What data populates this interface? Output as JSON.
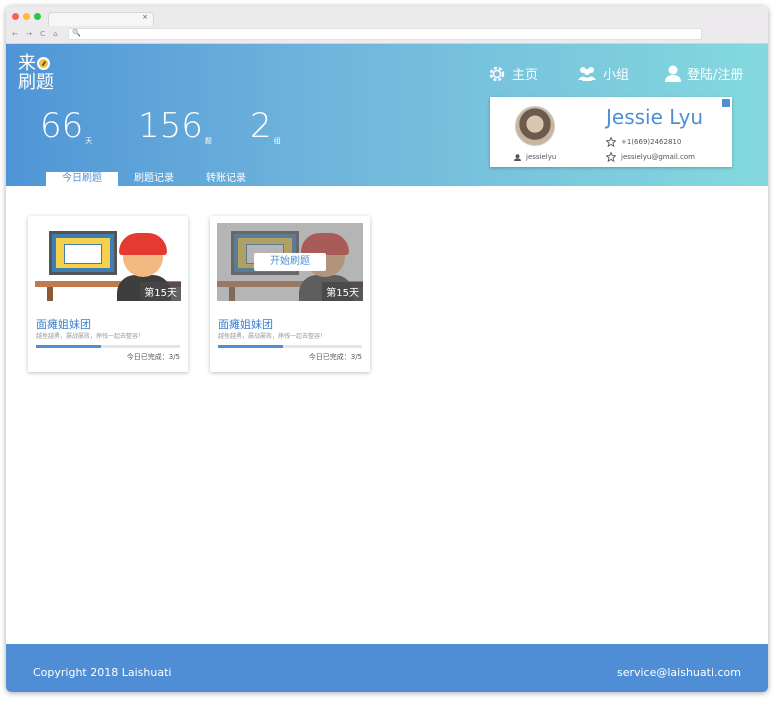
{
  "browser": {
    "tab_close": "×",
    "nav_glyphs": "← → C ⌂",
    "addr_icon": "🔍"
  },
  "brand": {
    "logo_line1": "来",
    "logo_line2": "刷题"
  },
  "stats": [
    {
      "value": "66",
      "unit": "天"
    },
    {
      "value": "156",
      "unit": "题"
    },
    {
      "value": "2",
      "unit": "组"
    }
  ],
  "nav": {
    "home": "主页",
    "group": "小组",
    "login": "登陆/注册"
  },
  "tabs": [
    {
      "label": "今日刷题"
    },
    {
      "label": "刷题记录"
    },
    {
      "label": "转账记录"
    }
  ],
  "profile": {
    "name": "Jessie Lyu",
    "username": "jessielyu",
    "phone": "+1(669)2462810",
    "email": "jessielyu@gmail.com"
  },
  "cards": [
    {
      "day": "第15天",
      "title": "面瘫姐妹团",
      "subtitle": "越挫越勇，屡战屡败，挣钱一起去整容！",
      "progress_text": "今日已完成：3/5",
      "progress": 0.45,
      "button": ""
    },
    {
      "day": "第15天",
      "title": "面瘫姐妹团",
      "subtitle": "越挫越勇，屡战屡败，挣钱一起去整容！",
      "progress_text": "今日已完成：3/5",
      "progress": 0.45,
      "button": "开始刷题"
    }
  ],
  "footer": {
    "copyright": "Copyright 2018 Laishuati",
    "email": "service@laishuati.com"
  },
  "colors": {
    "accent": "#4f8fd3",
    "hero_start": "#4f95d6",
    "hero_end": "#84d9de",
    "footer": "#4f8ed5"
  }
}
